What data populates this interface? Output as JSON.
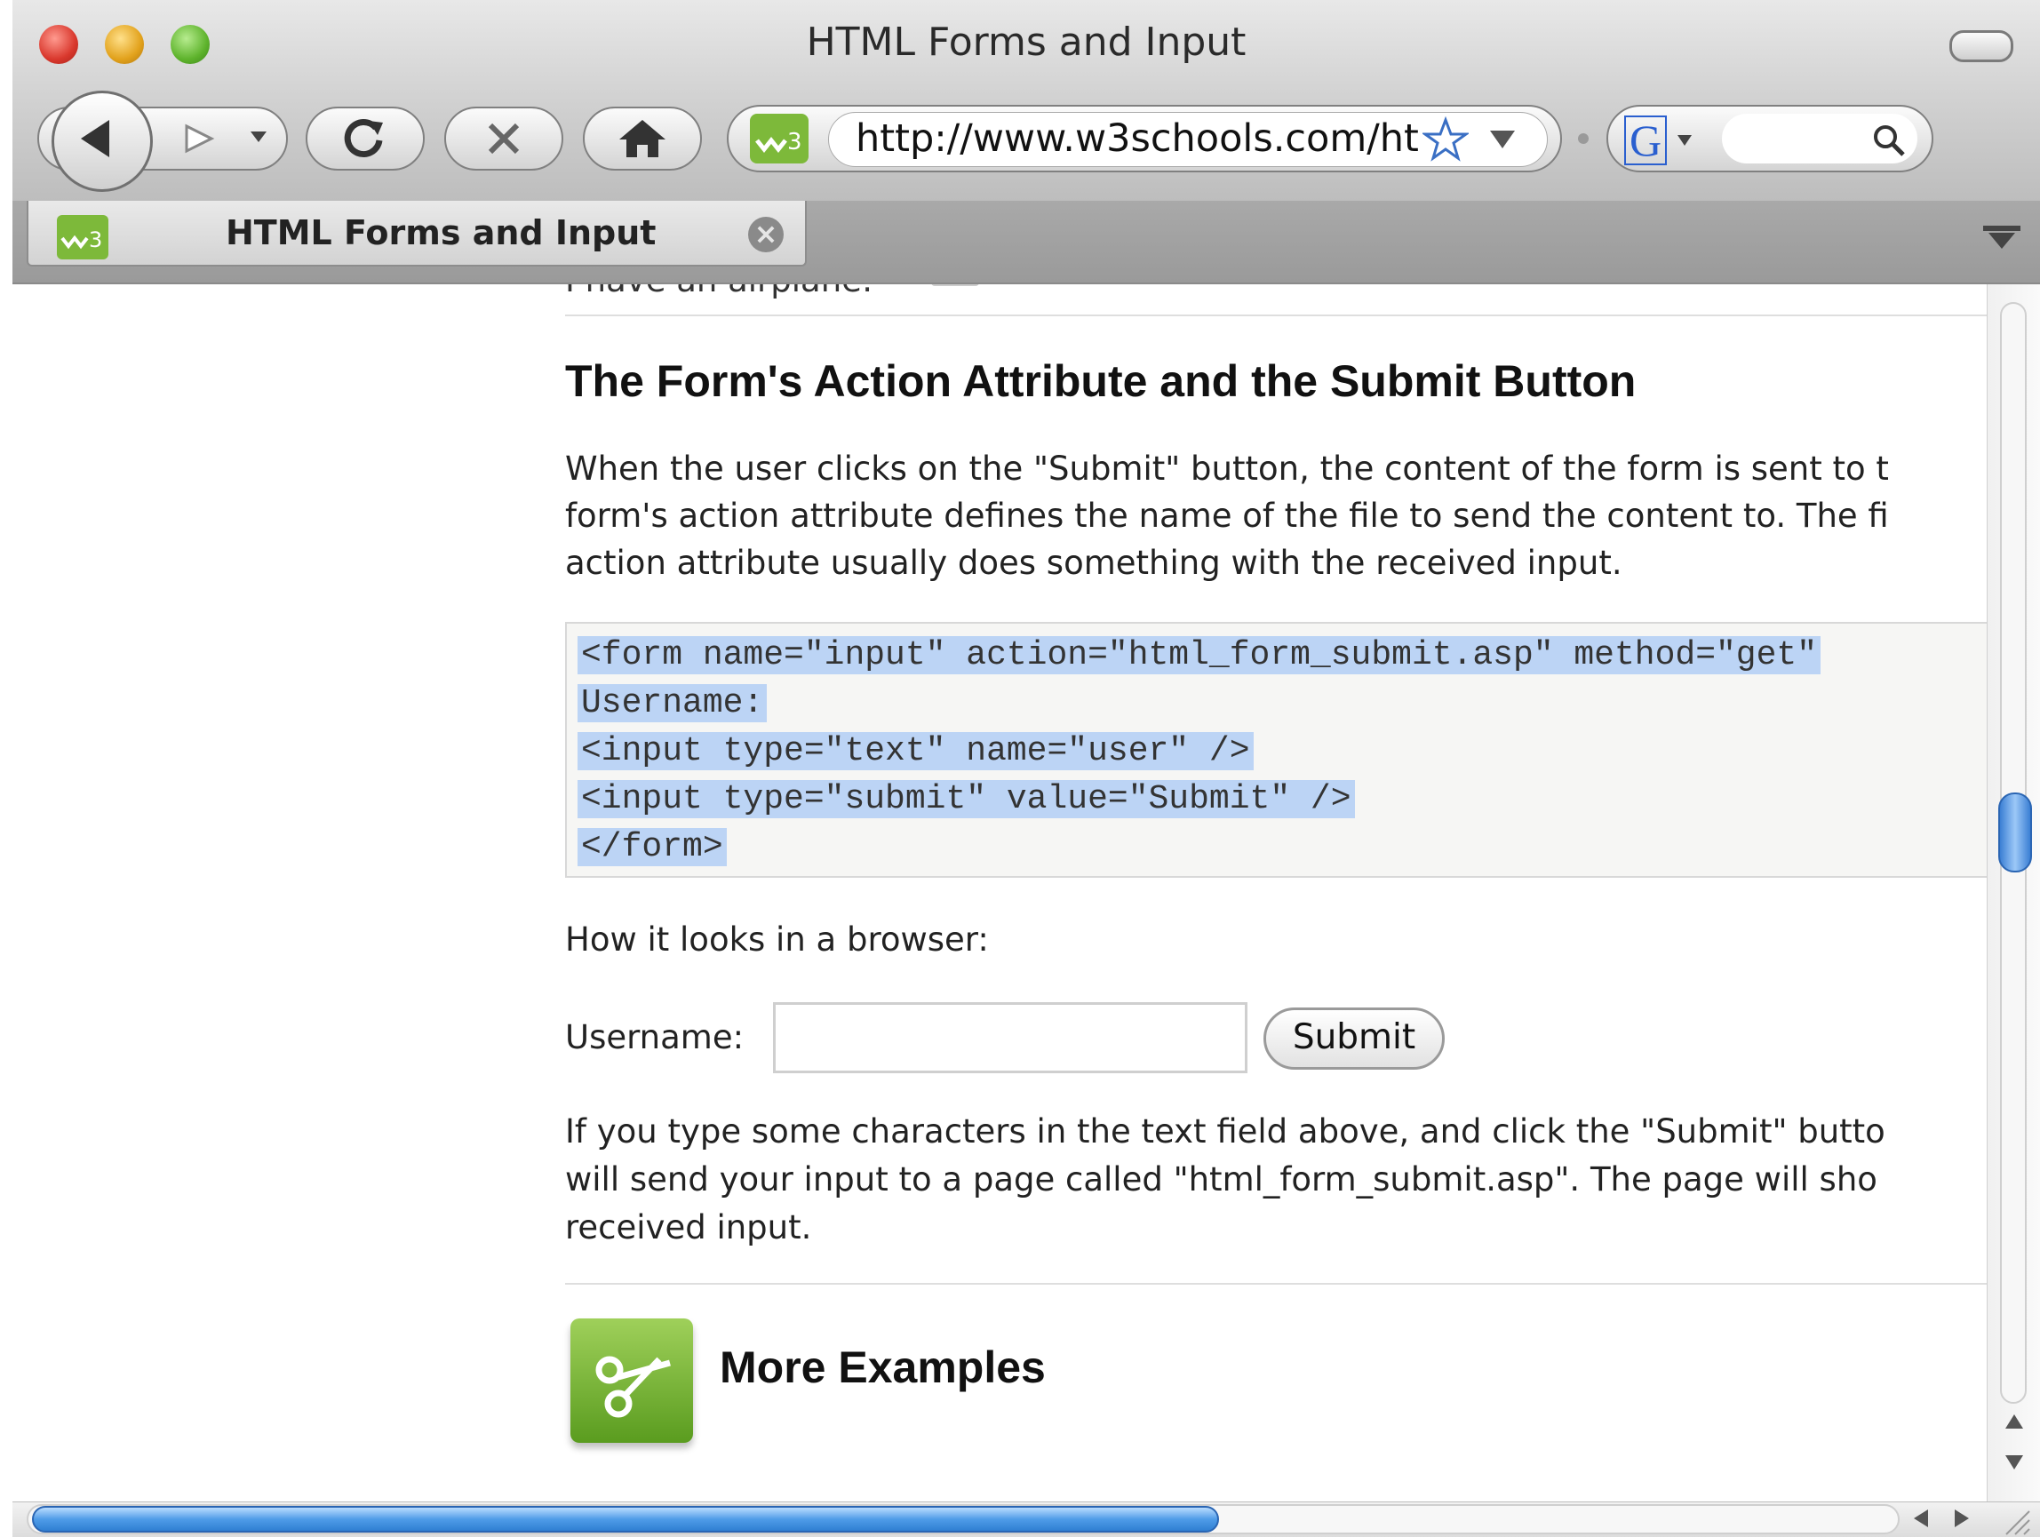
{
  "window": {
    "title": "HTML Forms and Input"
  },
  "toolbar": {
    "url": "http://www.w3schools.com/ht",
    "search_engine_letter": "G"
  },
  "tabs": [
    {
      "label": "HTML Forms and Input",
      "close": "×"
    }
  ],
  "page": {
    "clipped_top_text": "I have an airplane:",
    "heading": "The Form's Action Attribute and the Submit Button",
    "paragraph1_lines": [
      "When the user clicks on the \"Submit\" button, the content of the form is sent to t",
      "form's action attribute defines the name of the file to send the content to. The fi",
      "action attribute usually does something with the received input."
    ],
    "code_lines": [
      "<form name=\"input\" action=\"html_form_submit.asp\" method=\"get\"",
      "Username:",
      "<input type=\"text\" name=\"user\" />",
      "<input type=\"submit\" value=\"Submit\" />",
      "</form>"
    ],
    "browser_caption": "How it looks in a browser:",
    "username_label": "Username:",
    "username_value": "",
    "submit_label": "Submit",
    "paragraph2_lines": [
      "If you type some characters in the text field above, and click the \"Submit\" butto",
      "will send your input to a page called \"html_form_submit.asp\". The page will sho",
      "received input."
    ],
    "more_examples_heading": "More Examples"
  },
  "icons": {
    "back": "back-arrow-icon",
    "forward": "forward-arrow-icon",
    "reload": "reload-icon",
    "stop": "stop-icon",
    "home": "home-icon",
    "site": "w3schools-icon",
    "bookmark": "star-icon",
    "search": "magnifier-icon",
    "examples": "scissors-icon"
  },
  "colors": {
    "selection": "#bcd4f5",
    "scroll_thumb": "#4f9ce8",
    "w3_green": "#7db93a"
  }
}
